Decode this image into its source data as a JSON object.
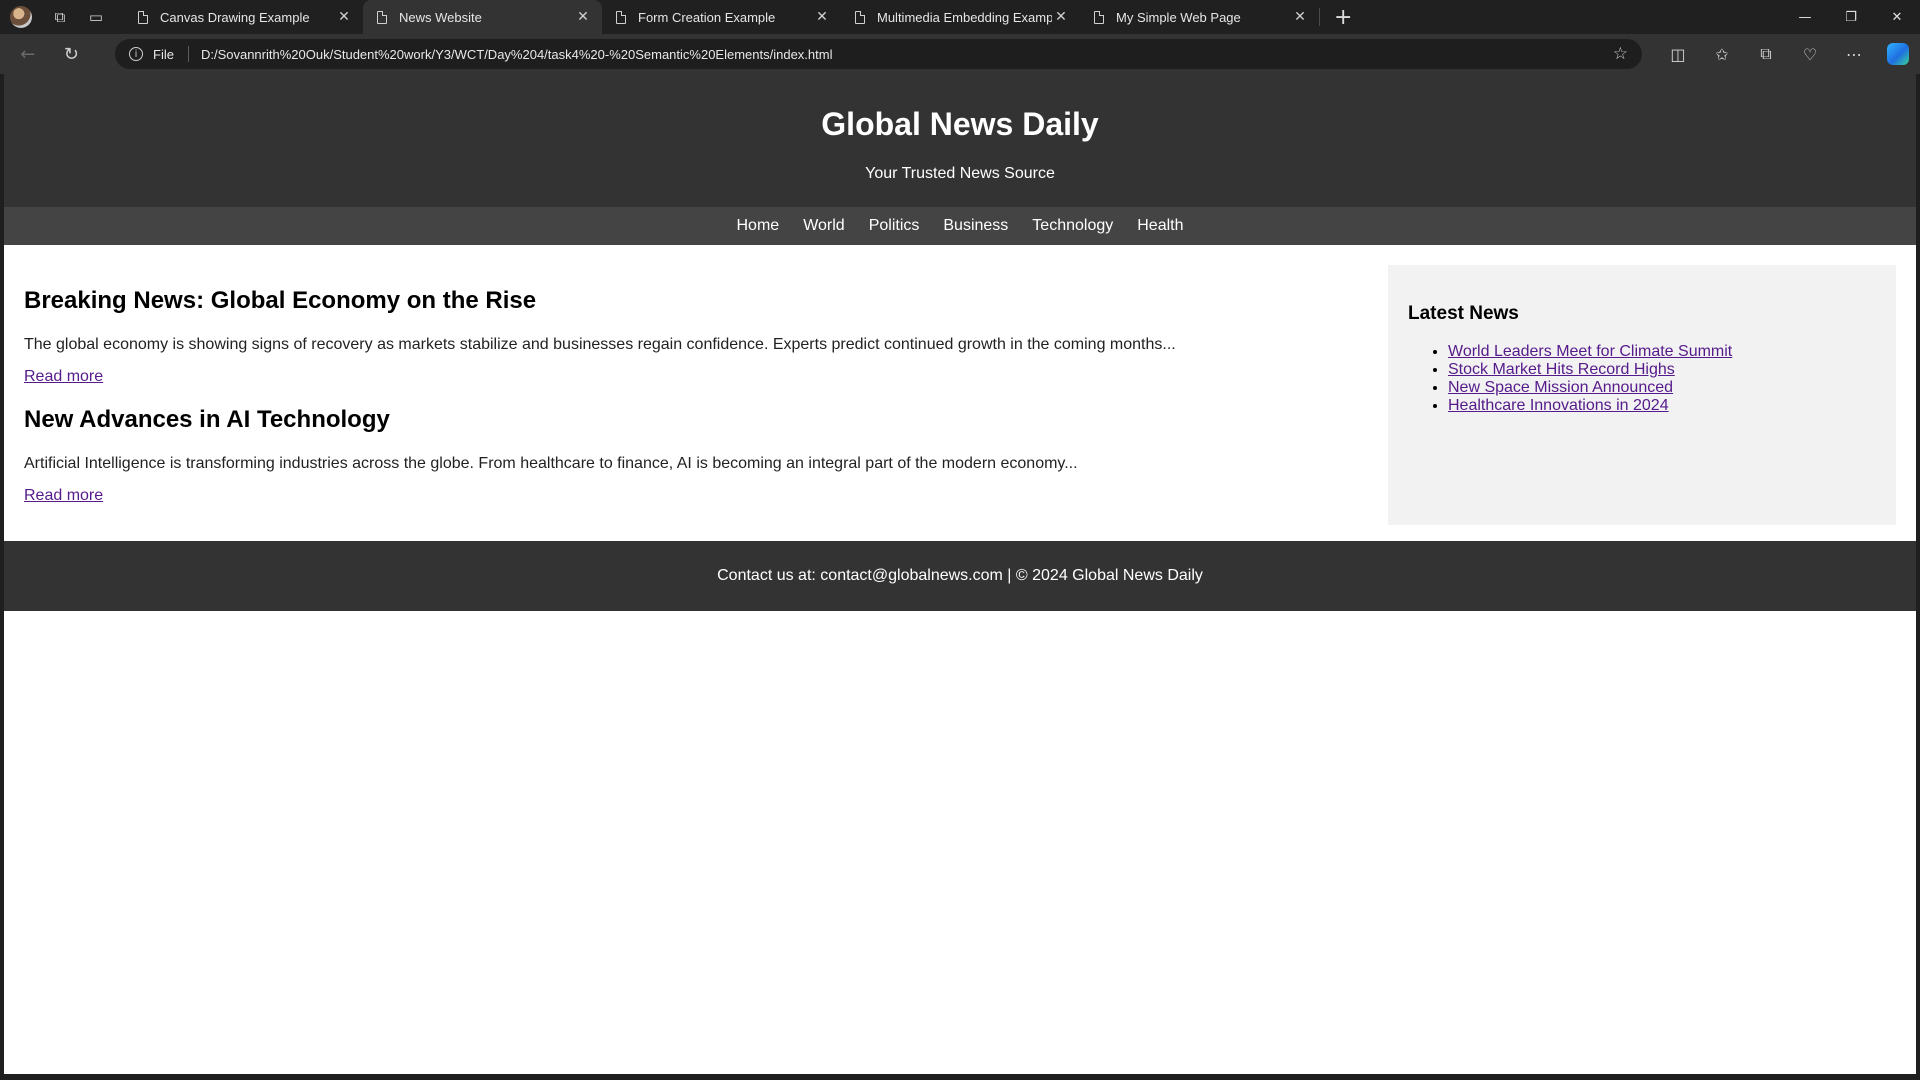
{
  "browser": {
    "tabs": [
      {
        "title": "Canvas Drawing Example",
        "active": false
      },
      {
        "title": "News Website",
        "active": true
      },
      {
        "title": "Form Creation Example",
        "active": false
      },
      {
        "title": "Multimedia Embedding Example",
        "active": false
      },
      {
        "title": "My Simple Web Page",
        "active": false
      }
    ],
    "address": {
      "scheme_label": "File",
      "url": "D:/Sovannrith%20Ouk/Student%20work/Y3/WCT/Day%204/task4%20-%20Semantic%20Elements/index.html"
    }
  },
  "page": {
    "header": {
      "title": "Global News Daily",
      "tagline": "Your Trusted News Source"
    },
    "nav": [
      "Home",
      "World",
      "Politics",
      "Business",
      "Technology",
      "Health"
    ],
    "articles": [
      {
        "title": "Breaking News: Global Economy on the Rise",
        "summary": "The global economy is showing signs of recovery as markets stabilize and businesses regain confidence. Experts predict continued growth in the coming months...",
        "link": "Read more"
      },
      {
        "title": "New Advances in AI Technology",
        "summary": "Artificial Intelligence is transforming industries across the globe. From healthcare to finance, AI is becoming an integral part of the modern economy...",
        "link": "Read more"
      }
    ],
    "sidebar": {
      "title": "Latest News",
      "items": [
        "World Leaders Meet for Climate Summit",
        "Stock Market Hits Record Highs",
        "New Space Mission Announced",
        "Healthcare Innovations in 2024"
      ]
    },
    "footer": {
      "text": "Contact us at: contact@globalnews.com | © 2024 Global News Daily"
    }
  }
}
